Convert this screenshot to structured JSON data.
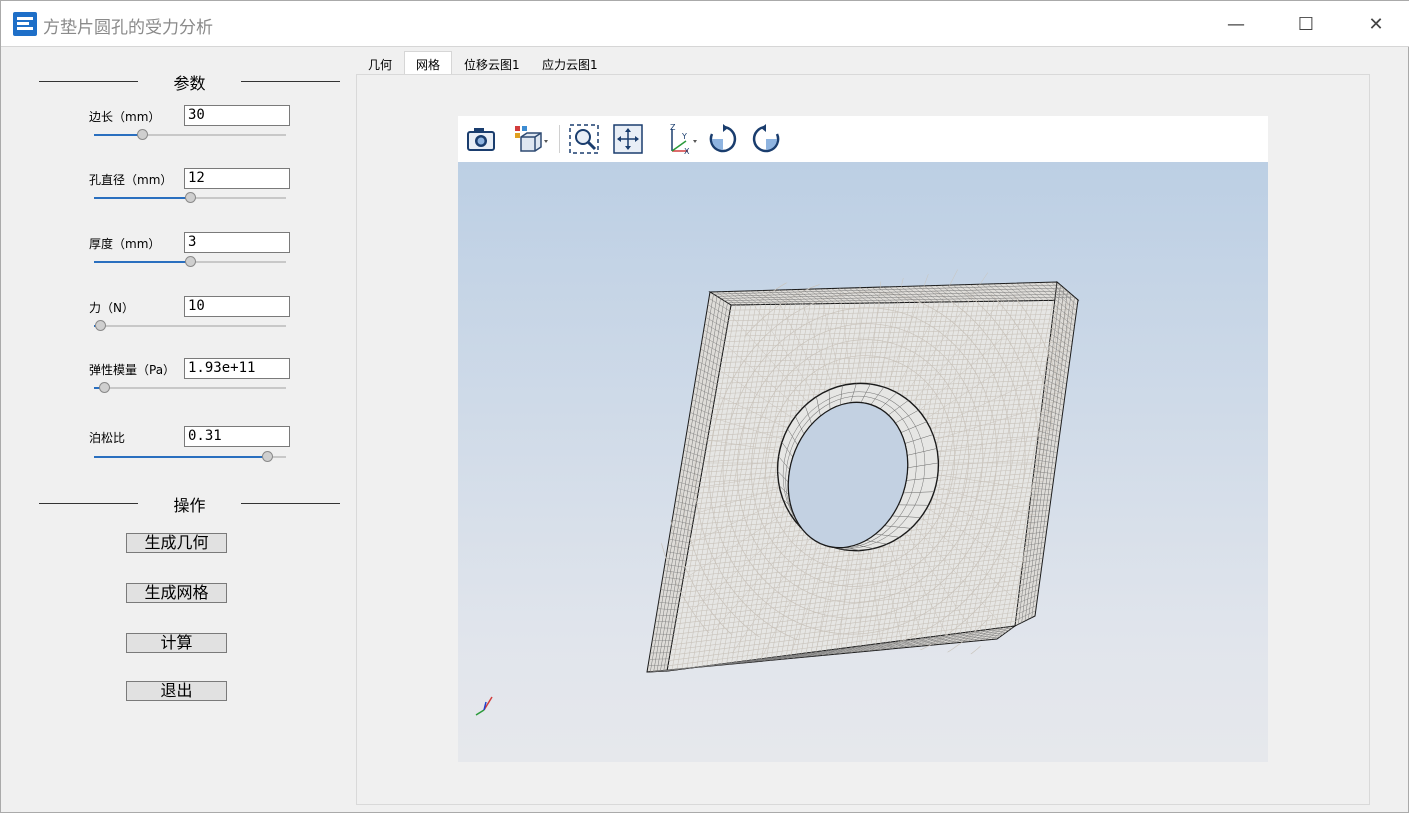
{
  "window": {
    "title": "方垫片圆孔的受力分析",
    "minimize_symbol": "—",
    "maximize_symbol": "☐",
    "close_symbol": "✕"
  },
  "params_group": {
    "title": "参数",
    "items": [
      {
        "label": "边长（mm）",
        "value": "30",
        "slider_fraction": 0.25
      },
      {
        "label": "孔直径（mm）",
        "value": "12",
        "slider_fraction": 0.5
      },
      {
        "label": "厚度（mm）",
        "value": "3",
        "slider_fraction": 0.5
      },
      {
        "label": "力（N）",
        "value": "10",
        "slider_fraction": 0.03
      },
      {
        "label": "弹性模量（Pa）",
        "value": "1.93e+11",
        "slider_fraction": 0.05
      },
      {
        "label": "泊松比",
        "value": "0.31",
        "slider_fraction": 0.9
      }
    ]
  },
  "actions_group": {
    "title": "操作",
    "buttons": [
      "生成几何",
      "生成网格",
      "计算",
      "退出"
    ]
  },
  "tabs": [
    {
      "label": "几何",
      "active": false
    },
    {
      "label": "网格",
      "active": true
    },
    {
      "label": "位移云图1",
      "active": false
    },
    {
      "label": "应力云图1",
      "active": false
    }
  ],
  "viewer": {
    "toolbar_icons": [
      "camera-icon",
      "view-cube-icon",
      "zoom-box-icon",
      "fit-all-icon",
      "axes-icon",
      "rotate-cw-icon",
      "rotate-ccw-icon"
    ],
    "axis_labels": {
      "x": "X",
      "y": "Y",
      "z": "Z"
    },
    "mesh_color": "#c9c3bb",
    "edge_color": "#1a1a1a",
    "background_top": "#bccfe4",
    "background_bottom": "#e6e8ec"
  },
  "colors": {
    "accent": "#2a6fbf",
    "app_icon": "#1e6fc8"
  }
}
